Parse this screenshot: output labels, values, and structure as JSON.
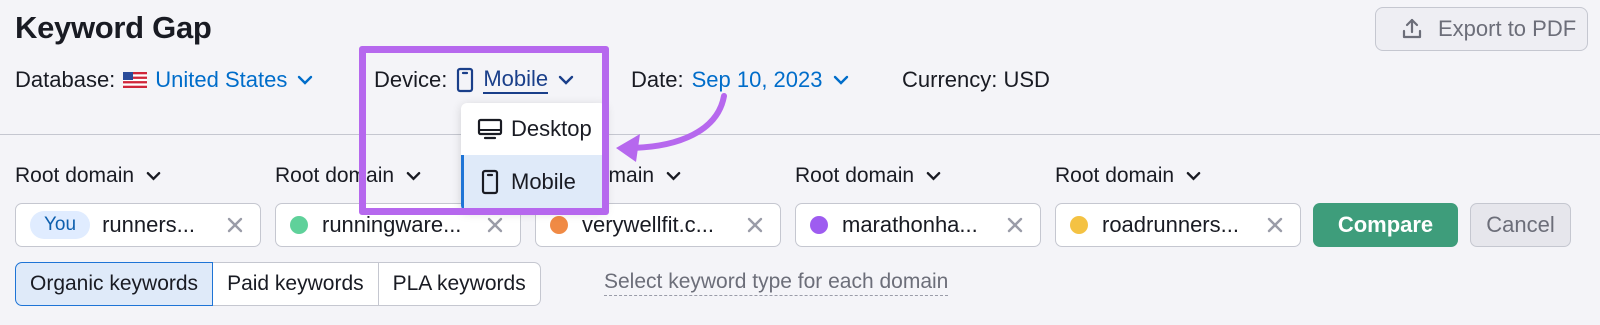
{
  "header": {
    "title": "Keyword Gap",
    "export_label": "Export to PDF"
  },
  "filters": {
    "database_label": "Database:",
    "database_value": "United States",
    "device_label": "Device:",
    "device_value": "Mobile",
    "date_label": "Date:",
    "date_value": "Sep 10, 2023",
    "currency_label": "Currency: USD"
  },
  "device_dropdown": {
    "options": [
      "Desktop",
      "Mobile"
    ],
    "selected": "Mobile"
  },
  "domains": [
    {
      "selector": "Root domain",
      "value": "runners...",
      "badge": "You",
      "color": ""
    },
    {
      "selector": "Root domain",
      "value": "runningware...",
      "color": "#5fd19a"
    },
    {
      "selector": "Root domain",
      "value": "verywellfit.c...",
      "color": "#f08a45"
    },
    {
      "selector": "Root domain",
      "value": "marathonha...",
      "color": "#9e5cf0"
    },
    {
      "selector": "Root domain",
      "value": "roadrunners...",
      "color": "#f4c243"
    }
  ],
  "actions": {
    "compare_label": "Compare",
    "cancel_label": "Cancel"
  },
  "keyword_types": {
    "tabs": [
      "Organic keywords",
      "Paid keywords",
      "PLA keywords"
    ],
    "selected": "Organic keywords",
    "link_label": "Select keyword type for each domain"
  },
  "colors": {
    "accent_link": "#006dca",
    "compare_green": "#3e9d7b",
    "highlight_purple": "#b668ee"
  }
}
